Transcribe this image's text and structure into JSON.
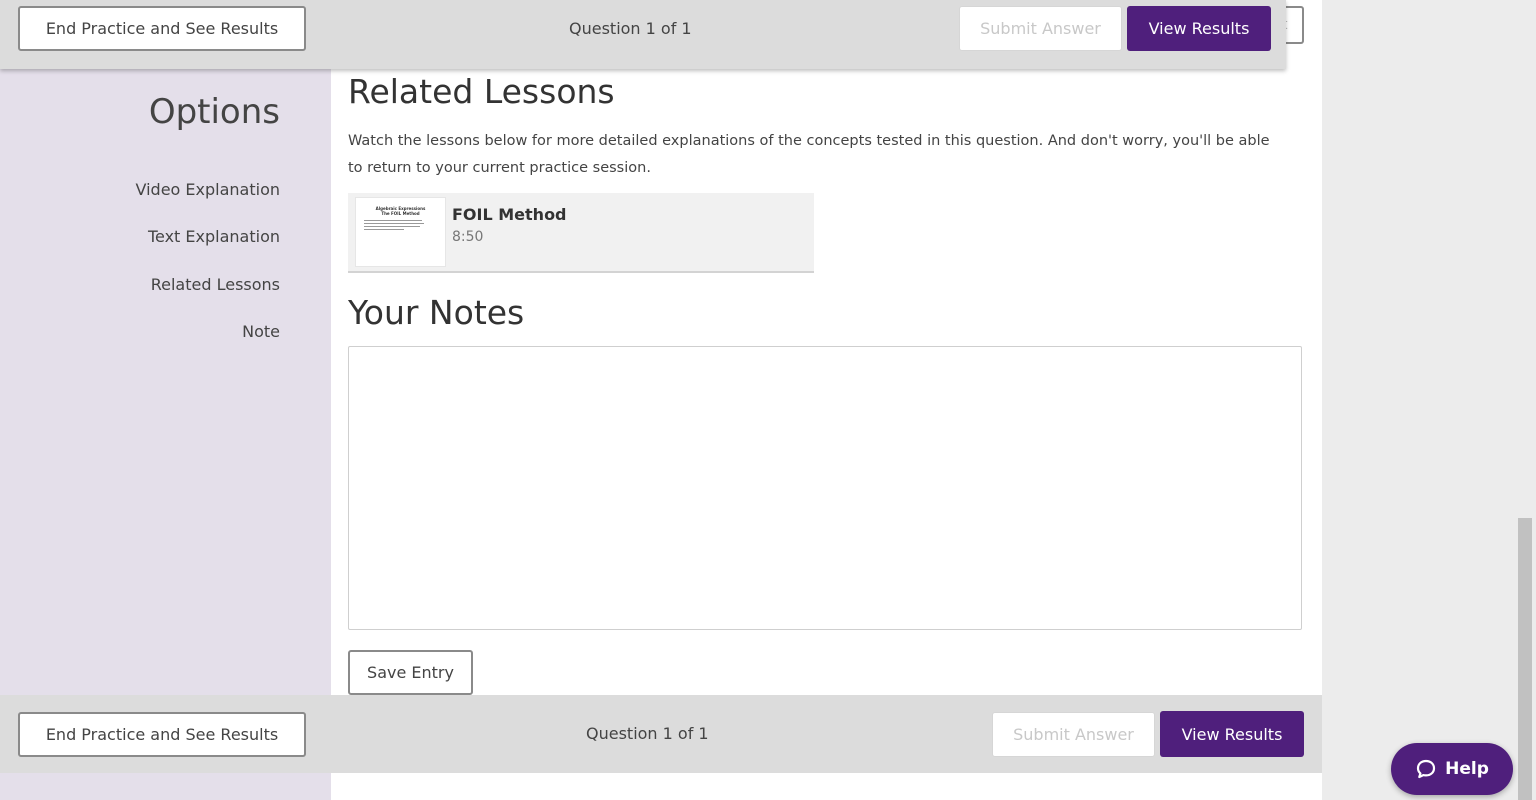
{
  "top_bar": {
    "end_practice": "End Practice and See Results",
    "question_counter": "Question 1 of 1",
    "submit_answer": "Submit Answer",
    "view_results": "View Results"
  },
  "sidebar": {
    "title": "Options",
    "items": [
      "Video Explanation",
      "Text Explanation",
      "Related Lessons",
      "Note"
    ]
  },
  "related_lessons": {
    "heading": "Related Lessons",
    "description": "Watch the lessons below for more detailed explanations of the concepts tested in this question. And don't worry, you'll be able to return to your current practice session.",
    "lessons": [
      {
        "title": "FOIL Method",
        "duration": "8:50",
        "thumbnail_title": "Algebraic Expressions\nThe FOIL Method"
      }
    ]
  },
  "notes": {
    "heading": "Your Notes",
    "value": "",
    "save_label": "Save Entry"
  },
  "bottom_bar": {
    "end_practice": "End Practice and See Results",
    "question_counter": "Question 1 of 1",
    "submit_answer": "Submit Answer",
    "view_results": "View Results"
  },
  "help": {
    "label": "Help"
  },
  "colors": {
    "accent": "#4f1f7c",
    "sidebar_bg": "#e4dfea",
    "bar_bg": "#dcdcdc"
  }
}
